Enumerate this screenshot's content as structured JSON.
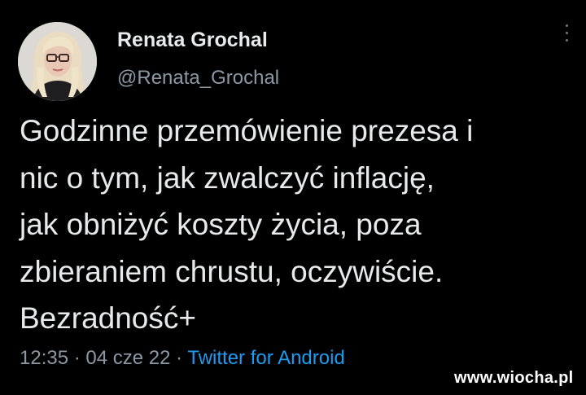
{
  "tweet": {
    "author": {
      "display_name": "Renata Grochal",
      "handle": "@Renata_Grochal",
      "avatar_icon": "profile-photo"
    },
    "text": "Godzinne przemówienie prezesa i\nnic o tym, jak zwalczyć inflację,\njak obniżyć koszty życia, poza\nzbieraniem chrustu, oczywiście.\nBezradność+",
    "time": "12:35",
    "date": "04 cze 22",
    "source": "Twitter for Android",
    "separator": " · ",
    "more_icon": "more-vertical-icon"
  },
  "watermark": "www.wiocha.pl",
  "colors": {
    "background": "#000000",
    "text_primary": "#e7e9ea",
    "text_secondary": "#8b98a5",
    "link": "#1d9bf0"
  }
}
